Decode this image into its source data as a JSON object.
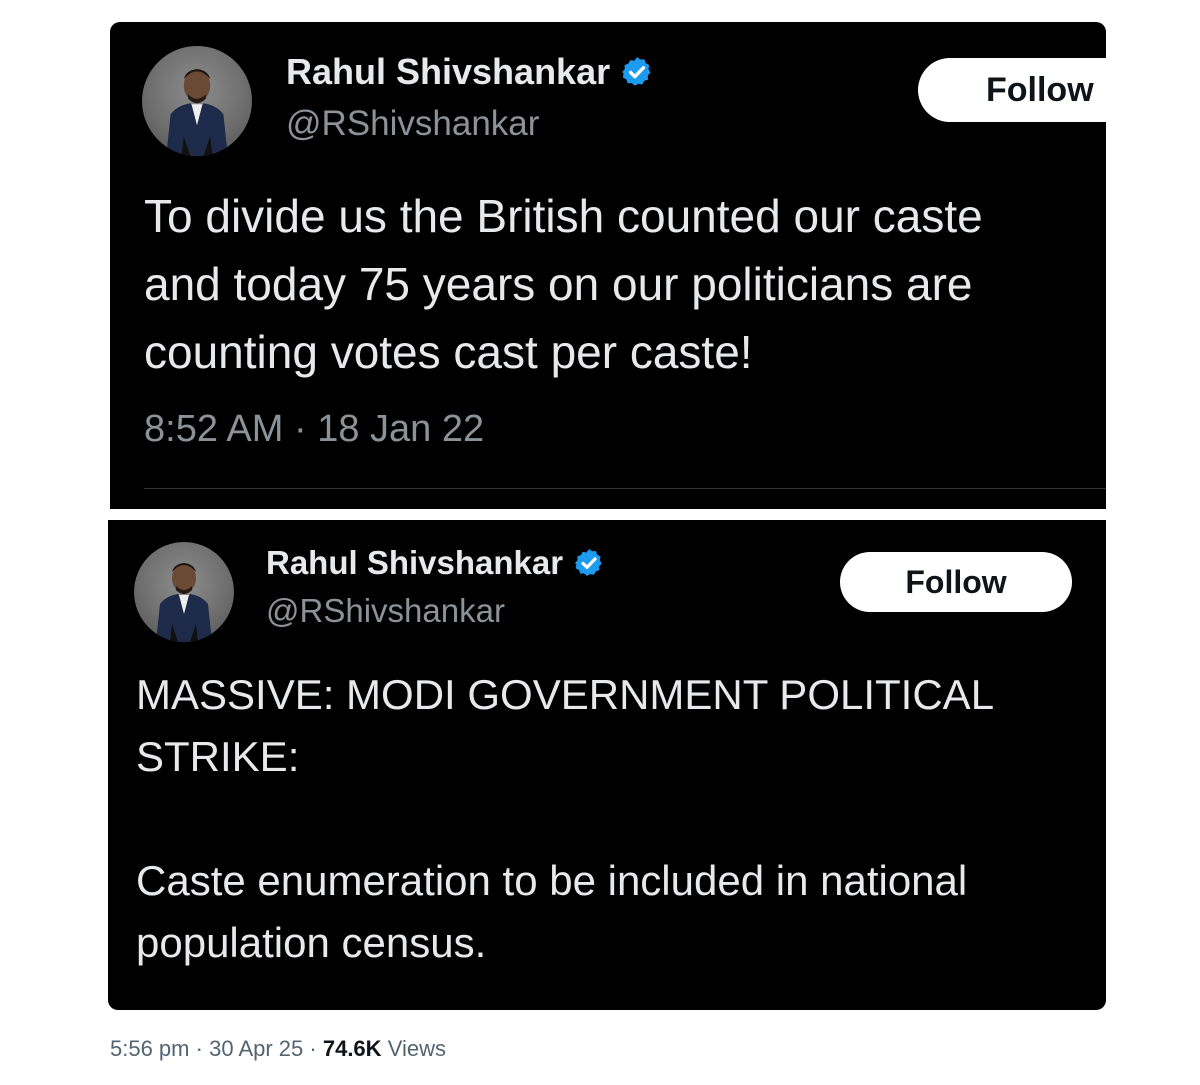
{
  "tweet_1": {
    "author_name": "Rahul Shivshankar",
    "handle": "@RShivshankar",
    "follow_label": "Follow",
    "text_lines": [
      "To divide us the British counted our caste",
      "and today 75 years on our politicians are",
      "counting votes cast per caste!"
    ],
    "timestamp": "8:52 AM · 18 Jan 22"
  },
  "tweet_2": {
    "author_name": "Rahul Shivshankar",
    "handle": "@RShivshankar",
    "follow_label": "Follow",
    "text_lines": [
      "MASSIVE: MODI GOVERNMENT POLITICAL",
      "STRIKE:",
      "",
      "Caste enumeration to be included in national",
      "population census."
    ]
  },
  "post_meta": {
    "time": "5:56 pm",
    "separator": "·",
    "date": "30 Apr 25",
    "views_count": "74.6K",
    "views_label": "Views"
  },
  "colors": {
    "card_background": "#000000",
    "verified_badge": "#1d9bf0",
    "secondary_text": "#8b9298"
  },
  "icons": {
    "verified": "verified-badge-icon",
    "avatar": "profile-photo"
  }
}
